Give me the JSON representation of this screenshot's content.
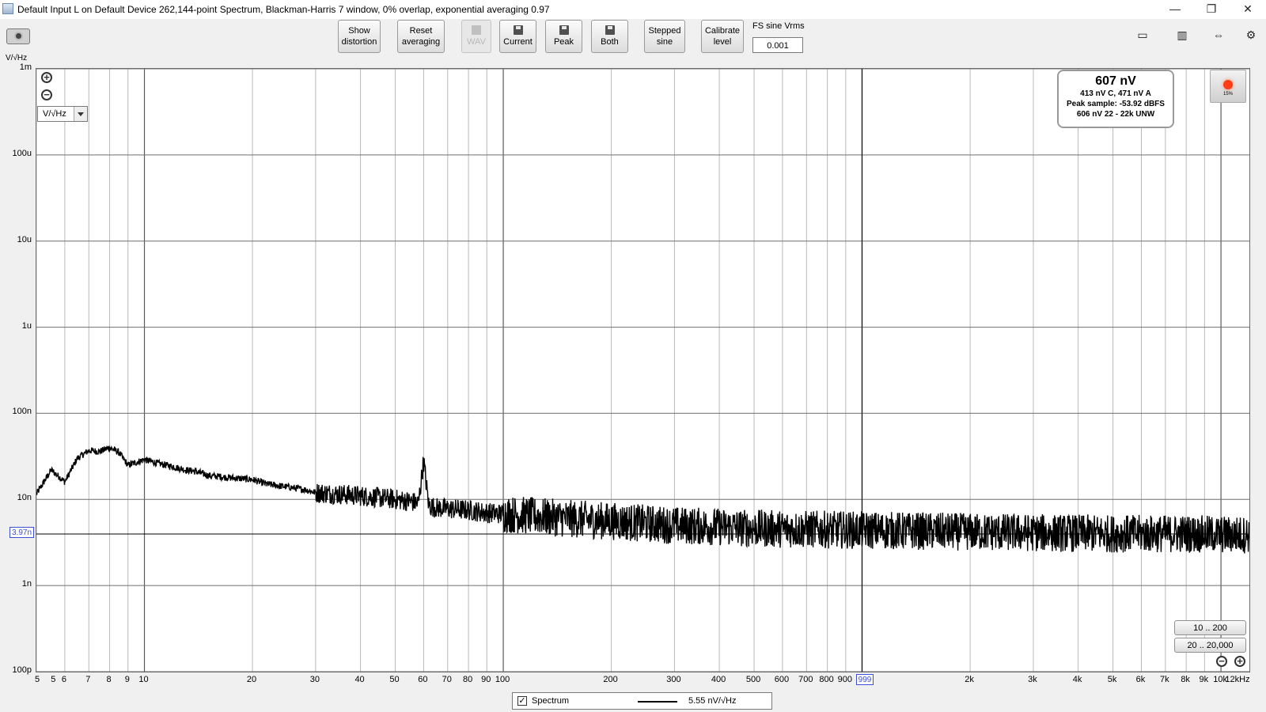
{
  "window": {
    "title": "Default Input L on Default Device 262,144-point Spectrum, Blackman-Harris 7 window, 0% overlap, exponential averaging 0.97",
    "controls": [
      "—",
      "❐",
      "✕"
    ]
  },
  "toolbar": {
    "show_distortion": [
      "Show",
      "distortion"
    ],
    "reset_averaging": [
      "Reset",
      "averaging"
    ],
    "wav": "WAV",
    "current": "Current",
    "peak": "Peak",
    "both": "Both",
    "stepped_sine": [
      "Stepped",
      "sine"
    ],
    "calibrate_level": [
      "Calibrate",
      "level"
    ],
    "fs_label": "FS sine Vrms",
    "fs_value": "0.001"
  },
  "plot": {
    "y_unit": "V/√Hz",
    "units_select": "V/√Hz",
    "y_marker": "3.97n",
    "x_marker": "999",
    "readout": {
      "main": "607 nV",
      "line1": "413 nV C, 471 nV A",
      "line2": "Peak sample: -53.92 dBFS",
      "line3": "606 nV 22 - 22k UNW"
    },
    "record_pct": "15%",
    "range_buttons": [
      "10 .. 200",
      "20 .. 20,000"
    ],
    "legend": {
      "name": "Spectrum",
      "value": "5.55 nV/√Hz",
      "checked": "✓"
    },
    "colors": {
      "trace": "#000000",
      "grid": "#9a9a9a",
      "marker": "#3b4fd8"
    }
  },
  "chart_data": {
    "type": "line",
    "title": "",
    "xlabel": "",
    "ylabel": "V/√Hz",
    "x_scale": "log",
    "y_scale": "log",
    "xlim": [
      5,
      12000
    ],
    "ylim": [
      1e-10,
      0.001
    ],
    "x_tick_labels": [
      "5",
      "5",
      "6",
      "7",
      "8",
      "9",
      "10",
      "20",
      "30",
      "40",
      "50",
      "60",
      "70",
      "80",
      "90",
      "100",
      "200",
      "300",
      "400",
      "500",
      "600",
      "700",
      "800",
      "900",
      "2k",
      "3k",
      "4k",
      "5k",
      "6k",
      "7k",
      "8k",
      "9k",
      "10k",
      "12kHz"
    ],
    "y_tick_labels": [
      "1m",
      "100u",
      "10u",
      "1u",
      "100n",
      "10n",
      "1n",
      "100p"
    ],
    "cursor_x": 999,
    "cursor_y": 3.97e-09,
    "series": [
      {
        "name": "Spectrum",
        "x": [
          5,
          5.5,
          6,
          6.5,
          7,
          7.5,
          8,
          8.5,
          9,
          9.5,
          10,
          11,
          12,
          13,
          14,
          15,
          17,
          20,
          22,
          25,
          28,
          30,
          35,
          40,
          45,
          50,
          55,
          58,
          60,
          62,
          65,
          70,
          80,
          90,
          100,
          150,
          200,
          300,
          400,
          500,
          700,
          1000,
          2000,
          3000,
          5000,
          8000,
          10000,
          12000
        ],
        "y": [
          1.15e-08,
          2.2e-08,
          1.6e-08,
          3e-08,
          3.7e-08,
          3.6e-08,
          4e-08,
          3.5e-08,
          2.5e-08,
          2.7e-08,
          2.9e-08,
          2.6e-08,
          2.4e-08,
          2.2e-08,
          2.1e-08,
          1.9e-08,
          1.8e-08,
          1.7e-08,
          1.5e-08,
          1.4e-08,
          1.3e-08,
          1.2e-08,
          1.15e-08,
          1.1e-08,
          1.05e-08,
          1e-08,
          9.5e-09,
          9e-09,
          2.8e-08,
          8.5e-09,
          8e-09,
          7.8e-09,
          7.5e-09,
          7e-09,
          6.8e-09,
          6e-09,
          5.6e-09,
          5e-09,
          4.8e-09,
          4.6e-09,
          4.5e-09,
          4.4e-09,
          4.2e-09,
          4.1e-09,
          4e-09,
          4e-09,
          3.9e-09,
          3.9e-09
        ]
      }
    ]
  }
}
